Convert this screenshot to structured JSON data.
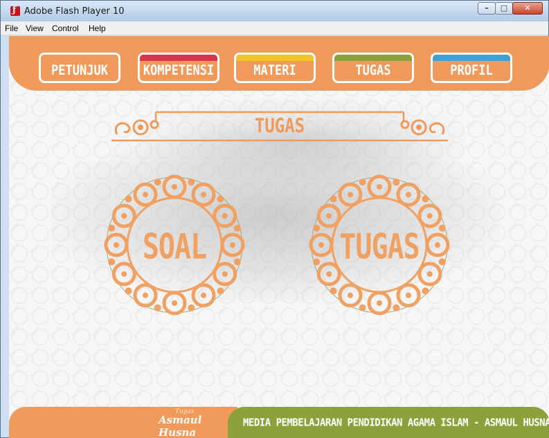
{
  "window": {
    "title": "Adobe Flash Player 10",
    "app_icon": "flash-player-icon",
    "controls": {
      "minimize": "–",
      "maximize": "□",
      "close": "✕"
    }
  },
  "menubar": {
    "items": [
      "File",
      "View",
      "Control",
      "Help"
    ]
  },
  "nav": {
    "items": [
      {
        "label": "PETUNJUK",
        "accent": "#ef9a5b"
      },
      {
        "label": "KOMPETENSI",
        "accent": "#d5364b"
      },
      {
        "label": "MATERI",
        "accent": "#f2c22a"
      },
      {
        "label": "TUGAS",
        "accent": "#8ba23c"
      },
      {
        "label": "PROFIL",
        "accent": "#3aa1d9"
      }
    ]
  },
  "heading": {
    "title": "TUGAS"
  },
  "options": [
    {
      "label": "SOAL"
    },
    {
      "label": "TUGAS"
    }
  ],
  "footer": {
    "logo_small": "Tugas",
    "logo": "Asmaul Husna",
    "text": "MEDIA PEMBELAJARAN PENDIDIKAN AGAMA ISLAM - ASMAUL HUSNA"
  },
  "colors": {
    "orange": "#ef9a5b",
    "green": "#8ba23c",
    "background": "#f6f6f6"
  }
}
